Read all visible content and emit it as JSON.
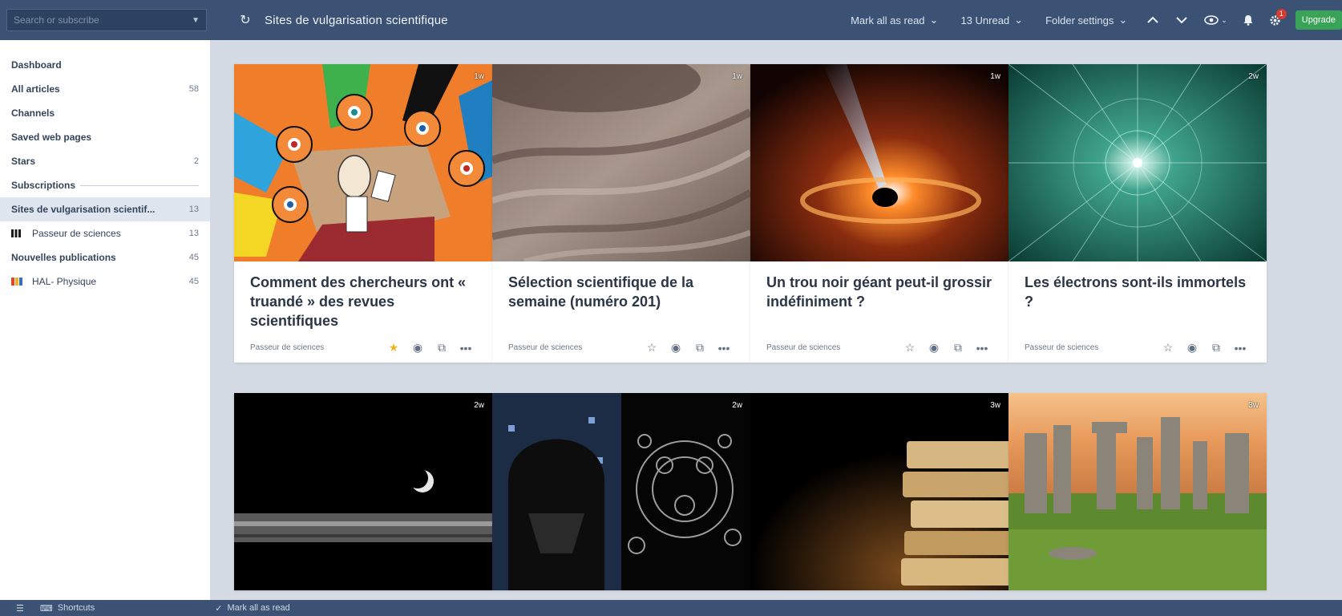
{
  "search": {
    "placeholder": "Search or subscribe"
  },
  "header": {
    "folder_title": "Sites de vulgarisation scientifique",
    "mark_all_read": "Mark all as read",
    "unread": "13 Unread",
    "folder_settings": "Folder settings",
    "notif_count": "1",
    "upgrade": "Upgrade"
  },
  "sidebar": {
    "items": [
      {
        "label": "Dashboard",
        "count": ""
      },
      {
        "label": "All articles",
        "count": "58"
      },
      {
        "label": "Channels",
        "count": ""
      },
      {
        "label": "Saved web pages",
        "count": ""
      },
      {
        "label": "Stars",
        "count": "2"
      }
    ],
    "subscriptions_header": "Subscriptions",
    "subscriptions": [
      {
        "label": "Sites de vulgarisation scientif...",
        "count": "13"
      },
      {
        "label": "Passeur de sciences",
        "count": "13"
      },
      {
        "label": "Nouvelles publications",
        "count": "45"
      },
      {
        "label": "HAL- Physique",
        "count": "45"
      }
    ]
  },
  "cards": [
    {
      "title": "Comment des chercheurs ont « truandé » des revues scientifiques",
      "source": "Passeur de sciences",
      "age": "1w",
      "starred": true
    },
    {
      "title": "Sélection scientifique de la semaine (numéro 201)",
      "source": "Passeur de sciences",
      "age": "1w",
      "starred": false
    },
    {
      "title": "Un trou noir géant peut-il grossir indéfiniment ?",
      "source": "Passeur de sciences",
      "age": "1w",
      "starred": false
    },
    {
      "title": "Les électrons sont-ils immortels ?",
      "source": "Passeur de sciences",
      "age": "2w",
      "starred": false
    },
    {
      "title": "",
      "source": "",
      "age": "2w",
      "starred": false
    },
    {
      "title": "",
      "source": "",
      "age": "2w",
      "starred": false
    },
    {
      "title": "",
      "source": "",
      "age": "3w",
      "starred": false
    },
    {
      "title": "",
      "source": "",
      "age": "3w",
      "starred": false
    }
  ],
  "bottom": {
    "shortcuts": "Shortcuts",
    "mark_all_read": "Mark all as read"
  }
}
